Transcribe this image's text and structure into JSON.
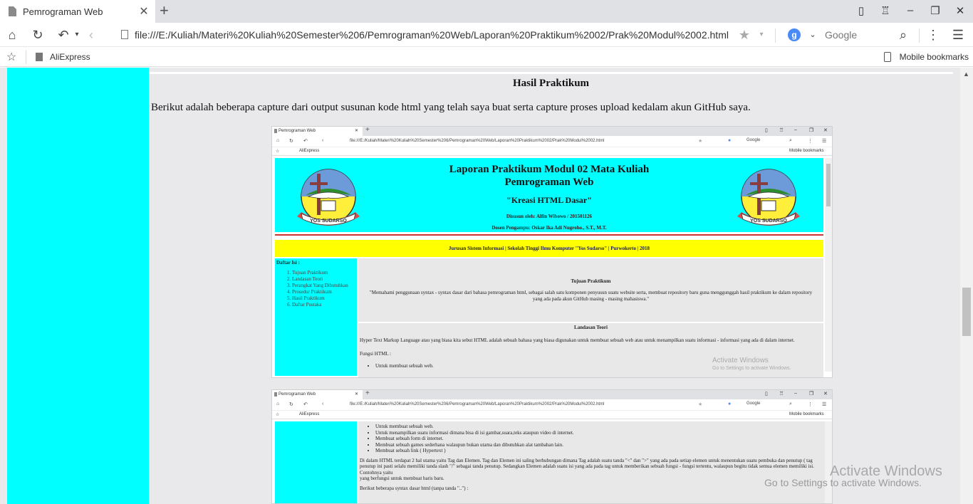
{
  "browser": {
    "tab_title": "Pemrograman Web",
    "tab_close": "✕",
    "new_tab": "+",
    "url": "file:///E:/Kuliah/Materi%20Kuliah%20Semester%206/Pemrograman%20Web/Laporan%20Praktikum%2002/Prak%20Modul%2002.html",
    "search_engine": "Google",
    "bookmark_item": "AliExpress",
    "mobile_bookmarks": "Mobile bookmarks"
  },
  "page": {
    "heading": "Hasil Praktikum",
    "intro": "Berikut adalah beberapa capture dari output susunan kode html yang telah saya buat serta capture proses upload kedalam akun GitHub saya."
  },
  "capture1": {
    "title_line1": "Laporan Praktikum Modul 02 Mata Kuliah",
    "title_line2": "Pemrograman Web",
    "subtitle": "\"Kreasi HTML Dasar\"",
    "author": "Disusun oleh: Alfin Wibowo / 201501126",
    "lecturer": "Dosen Pengampu: Oskar Ika Adi Nugroho., S.T., M.T.",
    "banner": "Jurusan Sistem Informasi | Sekolah Tinggi Ilmu Komputer \"Yos Sudarso\" | Purwokerto | 2018",
    "toc_label": "Daftar Isi :",
    "toc": [
      "Tujuan Praktikum",
      "Landasan Teori",
      "Perangkat Yang Dibutuhkan",
      "Prosedur Praktikum",
      "Hasil Praktikum",
      "Daftar Pustaka"
    ],
    "goal_heading": "Tujuan Praktikum",
    "goal_text": "\"Memahami penggunaan syntax - syntax dasar dari bahasa pemrograman html, sebagai salah satu komponen penyusun suatu website serta, membuat repository baru guna menggunggah hasil praktikum ke dalam repository yang ada pada akun GitHub masing - masing mahasiswa.\"",
    "theory_heading": "Landasan Teori",
    "theory_text": "Hyper Text Markup Language atau yang biasa kita sebut HTML adalah sebuah bahasa yang biasa digunakan untuk membuat sebuah web atau untuk menampilkan suatu informasi - informasi yang ada di dalam internet.",
    "function_label": "Fungsi HTML :",
    "function_item": "Untuk membuat sebuah web.",
    "logo_text": "YOS SUDARSO",
    "activate_title": "Activate Windows",
    "activate_sub": "Go to Settings to activate Windows."
  },
  "capture2": {
    "items": [
      "Untuk membuat sebuah web.",
      "Untuk menampilkan suatu informasi dimana bisa di isi gambar,suara,teks ataupun video di internet.",
      "Membuat sebuah form di internet.",
      "Membuat sebuah games sederhana walaupun bukan utama dan dibutuhkan alat tambahan lain.",
      "Membuat sebuah link ( Hypertext )"
    ],
    "paragraph": "Di dalam HTML terdapat 2 hal utama yaitu Tag dan Elemen. Tag dan Elemen ini saling berhubungan dimana Tag adalah suatu tanda \"<\" dan \">\" yang ada pada setiap elemen untuk menentukan suatu pembuka dan penutup ( tag penutup ini pasti selalu memiliki tanda slash \"/\" sebagai tanda penutup. Sedangkan Elemen adalah suatu isi yang ada pada tag untuk memberikan sebuah fungsi - fungsi tertentu, walaupun begitu tidak semua elemen memiliki isi. Contohnya yaitu",
    "paragraph_end": "yang berfungsi untuk membuat baris baru.",
    "syntax_line": "Berikut beberapa syntax dasar html (tanpa tanda \"..\") :"
  },
  "os": {
    "activate_title": "Activate Windows",
    "activate_sub": "Go to Settings to activate Windows."
  },
  "colors": {
    "cyan": "#00ffff",
    "yellow": "#ffff00",
    "page_bg": "#e9e9ec"
  }
}
